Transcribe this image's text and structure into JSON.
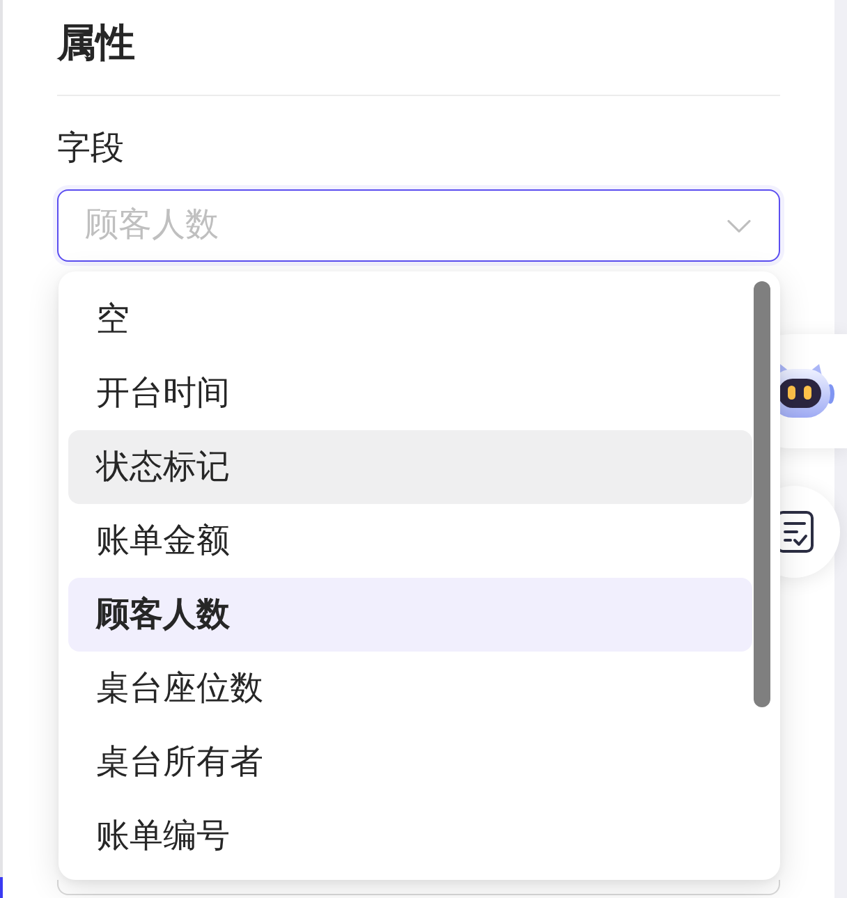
{
  "panel": {
    "title": "属性"
  },
  "field": {
    "label": "字段",
    "placeholder": "顾客人数",
    "focused": true
  },
  "dropdown": {
    "options": [
      {
        "label": "空",
        "selected": false,
        "hovered": false
      },
      {
        "label": "开台时间",
        "selected": false,
        "hovered": false
      },
      {
        "label": "状态标记",
        "selected": false,
        "hovered": true
      },
      {
        "label": "账单金额",
        "selected": false,
        "hovered": false
      },
      {
        "label": "顾客人数",
        "selected": true,
        "hovered": false
      },
      {
        "label": "桌台座位数",
        "selected": false,
        "hovered": false
      },
      {
        "label": "桌台所有者",
        "selected": false,
        "hovered": false
      },
      {
        "label": "账单编号",
        "selected": false,
        "hovered": false
      }
    ]
  }
}
